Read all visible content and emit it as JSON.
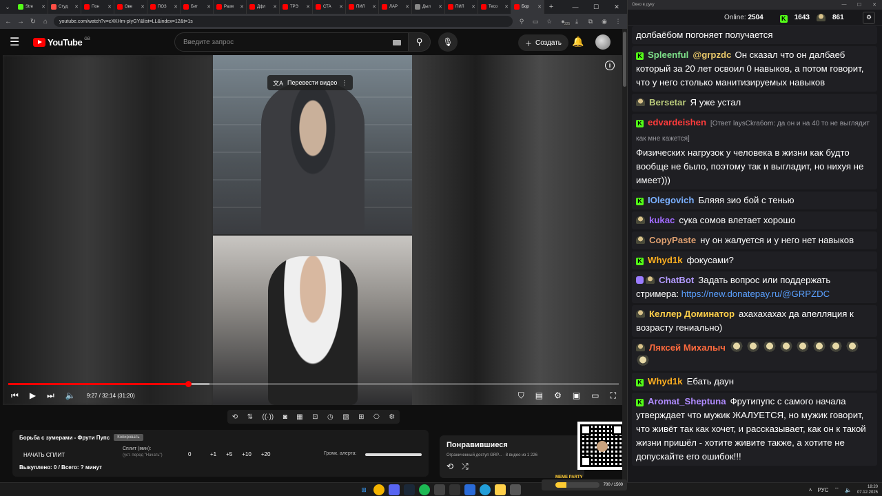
{
  "browser": {
    "tabs": [
      {
        "label": "Stre",
        "color": "#53fc18"
      },
      {
        "label": "Студ",
        "color": "#ff4e45"
      },
      {
        "label": "Пон",
        "color": "#ff0000"
      },
      {
        "label": "Ове",
        "color": "#ff0000"
      },
      {
        "label": "ПОЗ",
        "color": "#ff0000"
      },
      {
        "label": "Бит",
        "color": "#ff0000"
      },
      {
        "label": "Разм",
        "color": "#ff0000"
      },
      {
        "label": "Дфл",
        "color": "#ff0000"
      },
      {
        "label": "ТРЭ",
        "color": "#ff0000"
      },
      {
        "label": "СТА",
        "color": "#ff0000"
      },
      {
        "label": "ПИЛ",
        "color": "#ff0000"
      },
      {
        "label": "ЛАР",
        "color": "#ff0000"
      },
      {
        "label": "Дыл",
        "color": "#888888"
      },
      {
        "label": "ПИЛ",
        "color": "#ff0000"
      },
      {
        "label": "Тесо",
        "color": "#ff0000"
      },
      {
        "label": "Бор",
        "color": "#ff0000"
      }
    ],
    "url": "youtube.com/watch?v=cXKHm-pIyGY&list=LL&index=12&t=1s",
    "ext_count": "225"
  },
  "youtube": {
    "logo": "YouTube",
    "region": "GB",
    "search_placeholder": "Введите запрос",
    "create_label": "Создать"
  },
  "player": {
    "translate_label": "Перевести видео",
    "current_time": "9:27",
    "duration": "32:14",
    "remaining": "(31:20)",
    "progress": 0.295,
    "buffered": 0.33
  },
  "split": {
    "title": "Борьба с зумерами - Фрути Пупс",
    "copy_label": "Копировать",
    "start_label": "НАЧАТЬ СПЛИТ",
    "split_min_label": "Сплит (мин):",
    "split_hint": "(уст. перед \"Начать\")",
    "split_value": "0",
    "increments": [
      "+1",
      "+5",
      "+10",
      "+20"
    ],
    "alert_volume_label": "Громк. алерта:",
    "bought_text": "Выкуплено: 0 / Всего: ? минут"
  },
  "liked": {
    "title": "Понравившиеся",
    "meta": "Ограниченный доступ GRP... · 8 видео из 1 226"
  },
  "chat": {
    "window_title": "Окно в дуку",
    "online_label": "Online:",
    "online_count": "2504",
    "kick_count": "1643",
    "gold_count": "861",
    "messages": [
      {
        "badge": "",
        "user": "",
        "user_color": "#ffffff",
        "mention": "",
        "reply": "",
        "text": "долбаёбом погоняет получается"
      },
      {
        "badge": "k",
        "user": "Spleenful",
        "user_color": "#7ee08a",
        "mention": "@grpzdc",
        "reply": "",
        "text": "Он сказал что он далбаеб который за 20 лет освоил 0 навыков, а потом говорит, что у него столько манитизируемых навыков"
      },
      {
        "badge": "g",
        "user": "Bersetar",
        "user_color": "#b8c97a",
        "mention": "",
        "reply": "",
        "text": "Я уже устал"
      },
      {
        "badge": "k",
        "user": "edvardeishen",
        "user_color": "#ff3b3b",
        "mention": "",
        "reply": "[Ответ laysCkra6om: да он и на 40 то не выглядит как мне кажется]",
        "text": "Физических нагрузок у человека в жизни как будто вообще не было, поэтому так и выгладит, но нихуя не имеет)))"
      },
      {
        "badge": "k",
        "user": "IOlegovich",
        "user_color": "#7ab0ff",
        "mention": "",
        "reply": "",
        "text": "Бляяя зио бой с тенью"
      },
      {
        "badge": "g",
        "user": "kukac",
        "user_color": "#a06bff",
        "mention": "",
        "reply": "",
        "text": "сука сомов влетает хорошо"
      },
      {
        "badge": "g",
        "user": "CopyPaste",
        "user_color": "#e0a070",
        "mention": "",
        "reply": "",
        "text": "ну он жалуется и у него нет навыков"
      },
      {
        "badge": "k",
        "user": "Whyd1k",
        "user_color": "#ffb020",
        "mention": "",
        "reply": "",
        "text": "фокусами?"
      },
      {
        "badge": "bg",
        "user": "ChatBot",
        "user_color": "#b39bff",
        "mention": "",
        "reply": "",
        "text": "Задать вопрос или поддержать стримера: ",
        "link": "https://new.donatepay.ru/@GRPZDC"
      },
      {
        "badge": "g",
        "user": "Келлер Доминатор",
        "user_color": "#ffd04a",
        "mention": "",
        "reply": "",
        "text": "ахахахахах да апелляция к возрасту гениально)"
      },
      {
        "badge": "g",
        "user": "Ляксей Михалыч",
        "user_color": "#ff6a3d",
        "mention": "",
        "reply": "",
        "text": "",
        "emotes": 9
      },
      {
        "badge": "k",
        "user": "Whyd1k",
        "user_color": "#ffb020",
        "mention": "",
        "reply": "",
        "text": "Ебать даун"
      },
      {
        "badge": "k",
        "user": "Aromat_Sheptuna",
        "user_color": "#b08bff",
        "mention": "",
        "reply": "",
        "text": "Фрутипупс с самого начала утверждает что мужик ЖАЛУЕТСЯ, но мужик говорит, что живёт так как хочет, и рассказывает, как он к такой жизни пришёл - хотите живите также, а хотите не допускайте его ошибок!!!"
      }
    ]
  },
  "taskbar": {
    "meme_label": "MEME PARTY",
    "meme_count": "700 / 1500",
    "time": "18:20",
    "date": "07.12.2025",
    "lang": "РУС"
  }
}
